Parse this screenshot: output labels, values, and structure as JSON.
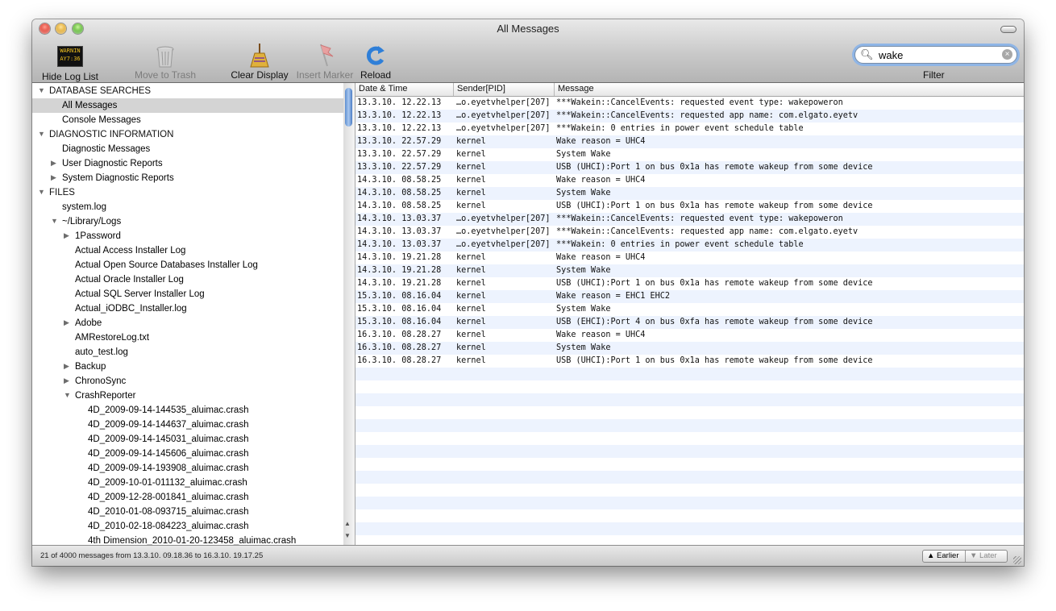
{
  "window": {
    "title": "All Messages"
  },
  "toolbar": {
    "hide_log_list": "Hide Log List",
    "move_to_trash": "Move to Trash",
    "clear_display": "Clear Display",
    "insert_marker": "Insert Marker",
    "reload": "Reload",
    "filter_label": "Filter",
    "warning_icon_text": "WARNIN",
    "warning_icon_sub": "AY7:36"
  },
  "search": {
    "value": "wake"
  },
  "sidebar": {
    "sections": [
      {
        "label": "DATABASE SEARCHES",
        "expanded": true
      },
      {
        "label": "DIAGNOSTIC INFORMATION",
        "expanded": true
      },
      {
        "label": "FILES",
        "expanded": true
      }
    ],
    "items": [
      {
        "label": "DATABASE SEARCHES",
        "level": 0,
        "tri": "down"
      },
      {
        "label": "All Messages",
        "level": 1,
        "tri": "",
        "selected": true
      },
      {
        "label": "Console Messages",
        "level": 1,
        "tri": ""
      },
      {
        "label": "DIAGNOSTIC INFORMATION",
        "level": 0,
        "tri": "down"
      },
      {
        "label": "Diagnostic Messages",
        "level": 1,
        "tri": ""
      },
      {
        "label": "User Diagnostic Reports",
        "level": 1,
        "tri": "right"
      },
      {
        "label": "System Diagnostic Reports",
        "level": 1,
        "tri": "right"
      },
      {
        "label": "FILES",
        "level": 0,
        "tri": "down"
      },
      {
        "label": "system.log",
        "level": 1,
        "tri": ""
      },
      {
        "label": "~/Library/Logs",
        "level": 1,
        "tri": "down"
      },
      {
        "label": "1Password",
        "level": 2,
        "tri": "right"
      },
      {
        "label": "Actual Access Installer Log",
        "level": 2,
        "tri": ""
      },
      {
        "label": "Actual Open Source Databases Installer Log",
        "level": 2,
        "tri": ""
      },
      {
        "label": "Actual Oracle Installer Log",
        "level": 2,
        "tri": ""
      },
      {
        "label": "Actual SQL Server Installer Log",
        "level": 2,
        "tri": ""
      },
      {
        "label": "Actual_iODBC_Installer.log",
        "level": 2,
        "tri": ""
      },
      {
        "label": "Adobe",
        "level": 2,
        "tri": "right"
      },
      {
        "label": "AMRestoreLog.txt",
        "level": 2,
        "tri": ""
      },
      {
        "label": "auto_test.log",
        "level": 2,
        "tri": ""
      },
      {
        "label": "Backup",
        "level": 2,
        "tri": "right"
      },
      {
        "label": "ChronoSync",
        "level": 2,
        "tri": "right"
      },
      {
        "label": "CrashReporter",
        "level": 2,
        "tri": "down"
      },
      {
        "label": "4D_2009-09-14-144535_aluimac.crash",
        "level": 3,
        "tri": ""
      },
      {
        "label": "4D_2009-09-14-144637_aluimac.crash",
        "level": 3,
        "tri": ""
      },
      {
        "label": "4D_2009-09-14-145031_aluimac.crash",
        "level": 3,
        "tri": ""
      },
      {
        "label": "4D_2009-09-14-145606_aluimac.crash",
        "level": 3,
        "tri": ""
      },
      {
        "label": "4D_2009-09-14-193908_aluimac.crash",
        "level": 3,
        "tri": ""
      },
      {
        "label": "4D_2009-10-01-011132_aluimac.crash",
        "level": 3,
        "tri": ""
      },
      {
        "label": "4D_2009-12-28-001841_aluimac.crash",
        "level": 3,
        "tri": ""
      },
      {
        "label": "4D_2010-01-08-093715_aluimac.crash",
        "level": 3,
        "tri": ""
      },
      {
        "label": "4D_2010-02-18-084223_aluimac.crash",
        "level": 3,
        "tri": ""
      },
      {
        "label": "4th Dimension_2010-01-20-123458_aluimac.crash",
        "level": 3,
        "tri": ""
      }
    ]
  },
  "table": {
    "columns": [
      "Date & Time",
      "Sender[PID]",
      "Message"
    ],
    "rows": [
      [
        "13.3.10. 12.22.13",
        "…o.eyetvhelper[207]",
        "***Wakein::CancelEvents: requested event type: wakepoweron"
      ],
      [
        "13.3.10. 12.22.13",
        "…o.eyetvhelper[207]",
        "***Wakein::CancelEvents: requested app name: com.elgato.eyetv"
      ],
      [
        "13.3.10. 12.22.13",
        "…o.eyetvhelper[207]",
        "***Wakein: 0 entries in power event schedule table"
      ],
      [
        "13.3.10. 22.57.29",
        "kernel",
        "Wake reason = UHC4"
      ],
      [
        "13.3.10. 22.57.29",
        "kernel",
        "System Wake"
      ],
      [
        "13.3.10. 22.57.29",
        "kernel",
        "USB (UHCI):Port 1 on bus 0x1a has remote wakeup from some device"
      ],
      [
        "14.3.10. 08.58.25",
        "kernel",
        "Wake reason = UHC4"
      ],
      [
        "14.3.10. 08.58.25",
        "kernel",
        "System Wake"
      ],
      [
        "14.3.10. 08.58.25",
        "kernel",
        "USB (UHCI):Port 1 on bus 0x1a has remote wakeup from some device"
      ],
      [
        "14.3.10. 13.03.37",
        "…o.eyetvhelper[207]",
        "***Wakein::CancelEvents: requested event type: wakepoweron"
      ],
      [
        "14.3.10. 13.03.37",
        "…o.eyetvhelper[207]",
        "***Wakein::CancelEvents: requested app name: com.elgato.eyetv"
      ],
      [
        "14.3.10. 13.03.37",
        "…o.eyetvhelper[207]",
        "***Wakein: 0 entries in power event schedule table"
      ],
      [
        "14.3.10. 19.21.28",
        "kernel",
        "Wake reason = UHC4"
      ],
      [
        "14.3.10. 19.21.28",
        "kernel",
        "System Wake"
      ],
      [
        "14.3.10. 19.21.28",
        "kernel",
        "USB (UHCI):Port 1 on bus 0x1a has remote wakeup from some device"
      ],
      [
        "15.3.10. 08.16.04",
        "kernel",
        "Wake reason = EHC1 EHC2"
      ],
      [
        "15.3.10. 08.16.04",
        "kernel",
        "System Wake"
      ],
      [
        "15.3.10. 08.16.04",
        "kernel",
        "USB (EHCI):Port 4 on bus 0xfa has remote wakeup from some device"
      ],
      [
        "16.3.10. 08.28.27",
        "kernel",
        "Wake reason = UHC4"
      ],
      [
        "16.3.10. 08.28.27",
        "kernel",
        "System Wake"
      ],
      [
        "16.3.10. 08.28.27",
        "kernel",
        "USB (UHCI):Port 1 on bus 0x1a has remote wakeup from some device"
      ]
    ]
  },
  "status": {
    "text": "21 of 4000 messages from 13.3.10. 09.18.36 to 16.3.10. 19.17.25",
    "earlier": "Earlier",
    "later": "Later"
  }
}
